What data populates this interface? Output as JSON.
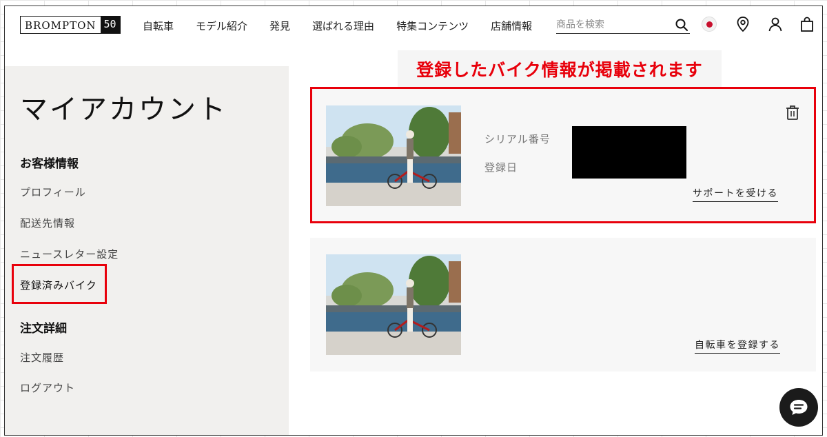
{
  "header": {
    "logo_text": "BROMPTON",
    "logo_num": "50",
    "nav": [
      "自転車",
      "モデル紹介",
      "発見",
      "選ばれる理由",
      "特集コンテンツ",
      "店舗情報"
    ],
    "search_placeholder": "商品を検索"
  },
  "sidebar": {
    "title": "マイアカウント",
    "section1_heading": "お客様情報",
    "items1": [
      "プロフィール",
      "配送先情報",
      "ニュースレター設定",
      "登録済みバイク"
    ],
    "section2_heading": "注文詳細",
    "items2": [
      "注文履歴",
      "ログアウト"
    ]
  },
  "annotation": {
    "banner": "登録したバイク情報が掲載されます",
    "color": "#e8000b"
  },
  "bikes": {
    "card1": {
      "serial_label": "シリアル番号",
      "date_label": "登録日",
      "support_link": "サポートを受ける"
    },
    "card2": {
      "register_link": "自転車を登録する"
    }
  },
  "icons": {
    "search": "search-icon",
    "flag": "japan-flag-icon",
    "location": "location-pin-icon",
    "account": "user-icon",
    "bag": "shopping-bag-icon",
    "trash": "trash-icon",
    "chat": "chat-icon"
  }
}
